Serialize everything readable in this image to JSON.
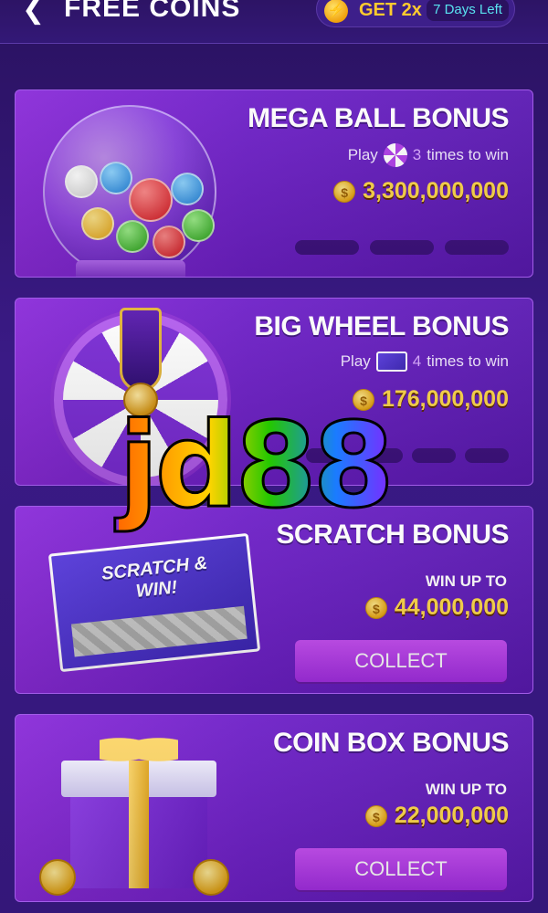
{
  "header": {
    "back_icon": "chevron-left-icon",
    "title": "FREE COINS",
    "boost": {
      "icon": "lightning-bolt-icon",
      "label": "GET 2x",
      "days_left": "7 Days Left"
    }
  },
  "cards": [
    {
      "title": "MEGA BALL BONUS",
      "play_prefix": "Play",
      "play_icon": "wheel-icon",
      "times": "3",
      "play_suffix": "times to win",
      "amount": "3,300,000,000",
      "progress": {
        "completed": 0,
        "total": 3
      }
    },
    {
      "title": "BIG WHEEL BONUS",
      "play_prefix": "Play",
      "play_icon": "scratch-ticket-icon",
      "times": "4",
      "play_suffix": "times to win",
      "amount": "176,000,000",
      "progress": {
        "completed": 0,
        "total": 4
      }
    },
    {
      "title": "SCRATCH BONUS",
      "win_label": "WIN UP TO",
      "amount": "44,000,000",
      "collect_label": "COLLECT",
      "art_text": "SCRATCH & WIN!"
    },
    {
      "title": "COIN BOX BONUS",
      "win_label": "WIN UP TO",
      "amount": "22,000,000",
      "collect_label": "COLLECT"
    }
  ],
  "watermark": "jd88",
  "colors": {
    "background": "#341779",
    "card": "#6e20c8",
    "gold": "#ffd84a",
    "collect": "#b83cf0",
    "days_left": "#59e3f0"
  }
}
